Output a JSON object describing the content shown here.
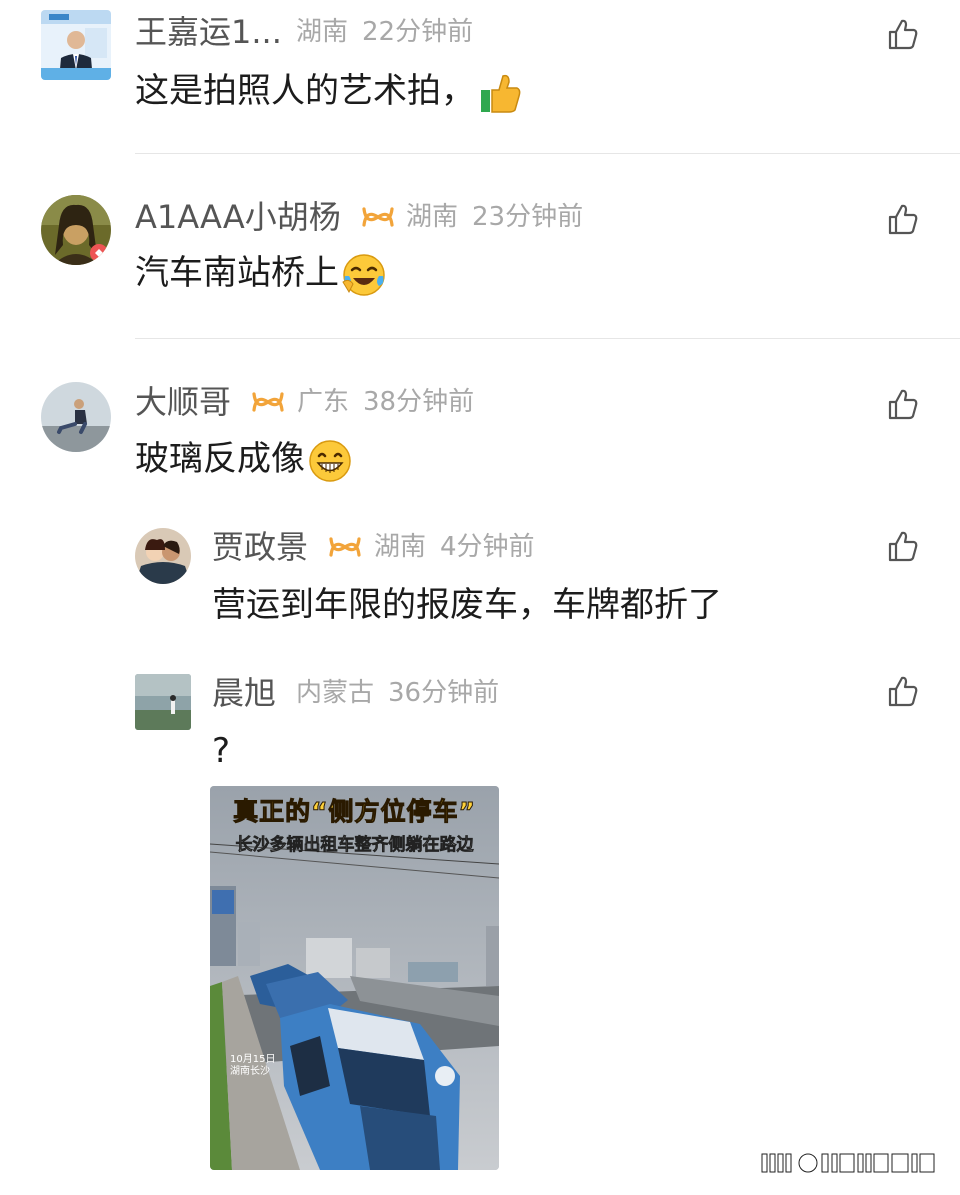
{
  "comments": [
    {
      "name": "王嘉运1...",
      "location": "湖南",
      "time": "22分钟前",
      "text": "这是拍照人的艺术拍，",
      "emoji": "thumbs-up-emoji",
      "badge": false
    },
    {
      "name": "A1AAA小胡杨",
      "location": "湖南",
      "time": "23分钟前",
      "text": "汽车南站桥上",
      "emoji": "laugh-cry-emoji",
      "badge": true
    },
    {
      "name": "大顺哥",
      "location": "广东",
      "time": "38分钟前",
      "text": "玻璃反成像",
      "emoji": "grin-emoji",
      "badge": true
    }
  ],
  "replies": [
    {
      "name": "贾政景",
      "location": "湖南",
      "time": "4分钟前",
      "text": "营运到年限的报废车，车牌都折了",
      "badge": true
    },
    {
      "name": "晨旭",
      "location": "内蒙古",
      "time": "36分钟前",
      "text": "?",
      "badge": false,
      "image": {
        "title": "真正的“侧方位停车”",
        "subtitle": "长沙多辆出租车整齐侧躺在路边",
        "date_line1": "10月15日",
        "date_line2": "湖南长沙"
      }
    }
  ],
  "colors": {
    "badge": "#f2a43a",
    "name": "#555555",
    "meta": "#a8a8a8",
    "divider": "#e6e6e6"
  }
}
